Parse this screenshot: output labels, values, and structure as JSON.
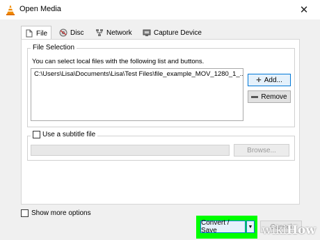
{
  "window": {
    "title": "Open Media",
    "close_glyph": "✕"
  },
  "tabs": [
    {
      "label": "File",
      "icon": "file-icon"
    },
    {
      "label": "Disc",
      "icon": "disc-icon"
    },
    {
      "label": "Network",
      "icon": "network-icon"
    },
    {
      "label": "Capture Device",
      "icon": "capture-device-icon"
    }
  ],
  "file_selection": {
    "legend": "File Selection",
    "hint": "You can select local files with the following list and buttons.",
    "files": [
      "C:\\Users\\Lisa\\Documents\\Lisa\\Test Files\\file_example_MOV_1280_1_..."
    ],
    "add_label": "Add...",
    "remove_label": "Remove"
  },
  "subtitle": {
    "label": "Use a subtitle file",
    "browse_label": "Browse..."
  },
  "more_options_label": "Show more options",
  "convert_save_label": "Convert / Save",
  "cancel_label": "Cancel",
  "watermark": {
    "part1": "wiki",
    "part2": "How"
  },
  "colors": {
    "highlight": "#00ff00",
    "accent": "#0078d7"
  }
}
